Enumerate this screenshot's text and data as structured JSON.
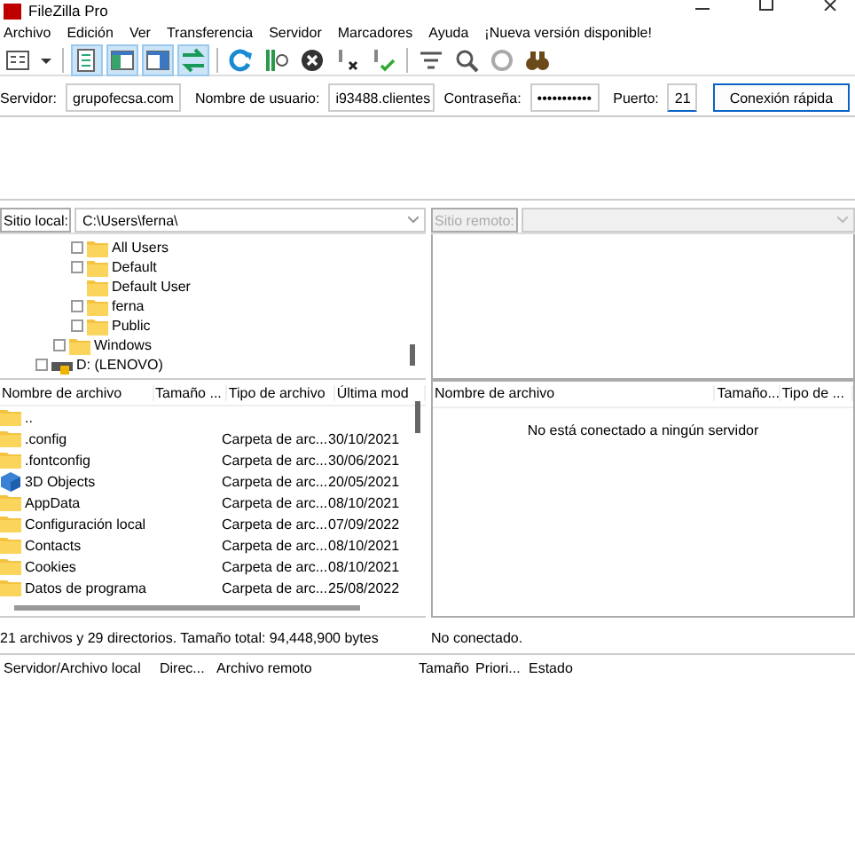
{
  "window": {
    "title": "FileZilla Pro"
  },
  "menu": [
    "Archivo",
    "Edición",
    "Ver",
    "Transferencia",
    "Servidor",
    "Marcadores",
    "Ayuda",
    "¡Nueva versión disponible!"
  ],
  "toolbar": [
    [
      {
        "kind": "site-manager",
        "pressed": false
      },
      {
        "kind": "caret",
        "pressed": false
      }
    ],
    [
      {
        "kind": "log",
        "pressed": true
      },
      {
        "kind": "local-tree",
        "pressed": true
      },
      {
        "kind": "remote-tree",
        "pressed": true
      },
      {
        "kind": "queue",
        "pressed": true
      }
    ],
    [
      {
        "kind": "refresh",
        "pressed": false
      },
      {
        "kind": "filter-process",
        "pressed": false
      },
      {
        "kind": "cancel",
        "pressed": false
      },
      {
        "kind": "disconnect",
        "pressed": false
      },
      {
        "kind": "reconnect",
        "pressed": false
      }
    ],
    [
      {
        "kind": "filter",
        "pressed": false
      },
      {
        "kind": "compare",
        "pressed": false
      },
      {
        "kind": "sync",
        "pressed": false
      },
      {
        "kind": "find",
        "pressed": false
      }
    ]
  ],
  "quickconnect": {
    "host_label": "Servidor:",
    "host": "grupofecsa.com",
    "user_label": "Nombre de usuario:",
    "user": "i93488.clientes",
    "password_label": "Contraseña:",
    "password": "•••••••••••",
    "port_label": "Puerto:",
    "port": "21",
    "button": "Conexión rápida"
  },
  "local": {
    "site_label": "Sitio local:",
    "path": "C:\\Users\\ferna\\",
    "tree": [
      {
        "children": [
          {
            "children": [
              {
                "label": "All Users",
                "kind": "folder",
                "expandable": true
              },
              {
                "label": "Default",
                "kind": "folder",
                "expandable": true
              },
              {
                "label": "Default User",
                "kind": "folder",
                "expandable": false
              },
              {
                "label": "ferna",
                "kind": "folder",
                "expandable": true
              },
              {
                "label": "Public",
                "kind": "folder",
                "expandable": true
              }
            ]
          },
          {
            "label": "Windows",
            "kind": "folder",
            "expandable": true
          }
        ]
      },
      {
        "label": "D: (LENOVO)",
        "kind": "drive",
        "expandable": true
      }
    ],
    "columns": [
      "Nombre de archivo",
      "Tamaño ...",
      "Tipo de archivo",
      "Última mod"
    ],
    "rows": [
      {
        "name": "..",
        "kind": "folder",
        "type": "",
        "modified": ""
      },
      {
        "name": ".config",
        "kind": "folder",
        "type": "Carpeta de arc...",
        "modified": "30/10/2021"
      },
      {
        "name": ".fontconfig",
        "kind": "folder",
        "type": "Carpeta de arc...",
        "modified": "30/06/2021"
      },
      {
        "name": "3D Objects",
        "kind": "objects",
        "type": "Carpeta de arc...",
        "modified": "20/05/2021"
      },
      {
        "name": "AppData",
        "kind": "folder",
        "type": "Carpeta de arc...",
        "modified": "08/10/2021"
      },
      {
        "name": "Configuración local",
        "kind": "folder",
        "type": "Carpeta de arc...",
        "modified": "07/09/2022"
      },
      {
        "name": "Contacts",
        "kind": "folder",
        "type": "Carpeta de arc...",
        "modified": "08/10/2021"
      },
      {
        "name": "Cookies",
        "kind": "folder",
        "type": "Carpeta de arc...",
        "modified": "08/10/2021"
      },
      {
        "name": "Datos de programa",
        "kind": "folder",
        "type": "Carpeta de arc...",
        "modified": "25/08/2022"
      }
    ],
    "status": "21 archivos y 29 directorios. Tamaño total: 94,448,900 bytes"
  },
  "remote": {
    "site_label": "Sitio remoto:",
    "columns": [
      "Nombre de archivo",
      "Tamaño...",
      "Tipo de ..."
    ],
    "message": "No está conectado a ningún servidor",
    "status": "No conectado."
  },
  "queue": {
    "columns": [
      "Servidor/Archivo local",
      "Direc...",
      "Archivo remoto",
      "Tamaño",
      "Priori...",
      "Estado"
    ]
  }
}
